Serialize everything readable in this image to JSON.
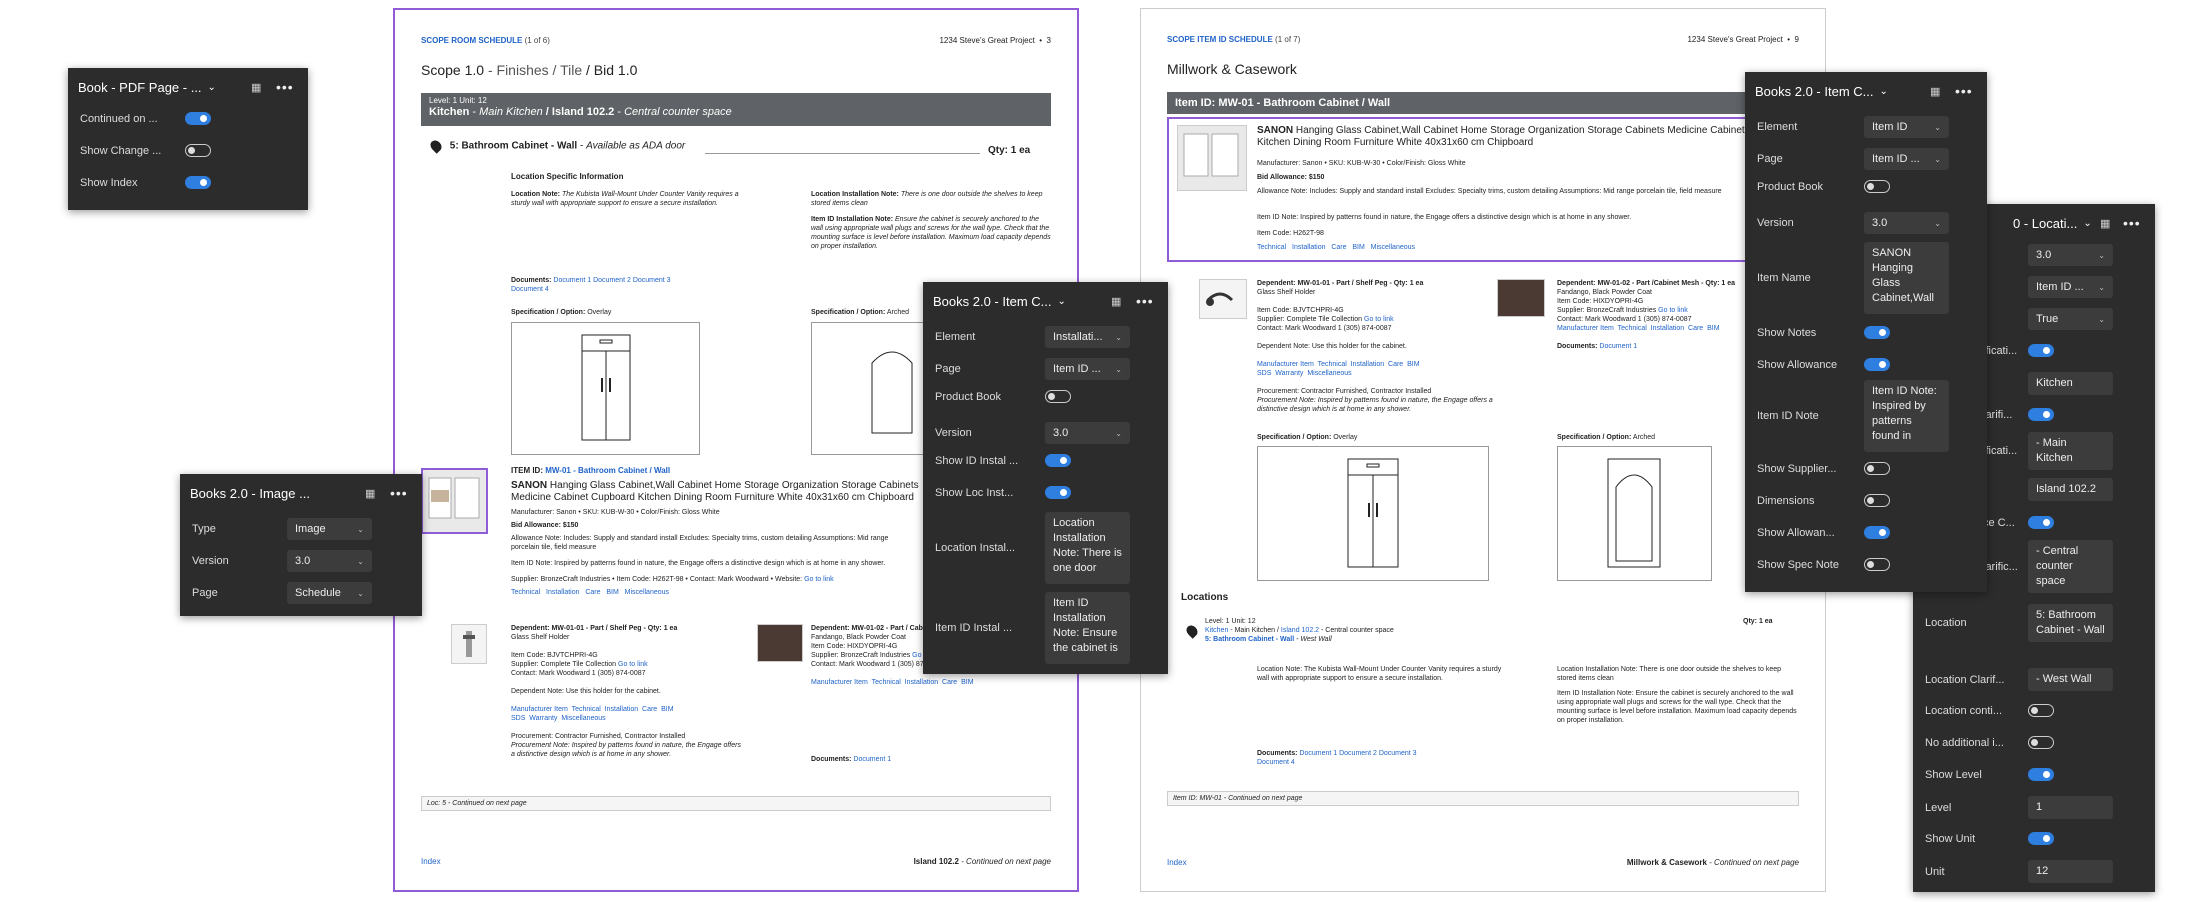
{
  "page1": {
    "header_left": "SCOPE ROOM SCHEDULE",
    "header_count": "(1 of 6)",
    "header_project": "1234 Steve's Great Project",
    "header_num": "3",
    "title_scope": "Scope 1.0",
    "title_sep1": "-",
    "title_finish": "Finishes / Tile",
    "title_sep2": "/",
    "title_bid": "Bid 1.0",
    "band_level": "Level: 1 Unit: 12",
    "band_room": "Kitchen",
    "band_dash": "-",
    "band_main": "Main Kitchen",
    "band_slash": "/",
    "band_island": "Island 102.2",
    "band_dash2": "-",
    "band_desc": "Central counter space",
    "loc_item": "5: Bathroom Cabinet - Wall",
    "loc_dash": "-",
    "loc_avail": "Available as ADA door",
    "qty": "Qty: 1 ea",
    "lsi": "Location Specific Information",
    "loc_note_label": "Location Note:",
    "loc_note": "The Kubista Wall-Mount Under Counter Vanity requires a sturdy wall with appropriate support to ensure a secure installation.",
    "lin_label": "Location Installation Note:",
    "lin_note": "There is one door outside the shelves to keep stored items clean",
    "iin_label": "Item ID Installation Note:",
    "iin_note": "Ensure the cabinet is securely anchored to the wall using appropriate wall plugs and screws for the wall type. Check that the mounting surface is level before installation. Maximum load capacity depends on proper installation.",
    "docs_label": "Documents:",
    "docs": [
      "Document 1",
      "Document 2",
      "Document 3",
      "Document 4"
    ],
    "spec_label": "Specification / Option:",
    "spec_left": "Overlay",
    "spec_right": "Arched",
    "item_id_label": "ITEM ID:",
    "item_id": "MW-01 - Bathroom Cabinet / Wall",
    "item_brand": "SANON",
    "item_desc": "Hanging Glass Cabinet,Wall Cabinet Home Storage Organization Storage Cabinets Medicine Cabinet Cupboard Kitchen Dining Room Furniture White 40x31x60 cm Chipboard",
    "mfr_line": "Manufacturer: Sanon  •  SKU: KUB-W-30  •  Color/Finish: Gloss White",
    "bid_allow": "Bid Allowance: $150",
    "allow_note": "Allowance Note: Includes: Supply and standard install  Excludes: Specialty trims, custom detailing  Assumptions: Mid range porcelain tile, field measure",
    "itemid_note": "Item ID Note: Inspired by patterns found in nature, the Engage offers a distinctive design which is at home in any shower.",
    "supplier_line": "Supplier: BronzeCraft Industries  •  Item Code: H262T-98  •  Contact: Mark Woodward  •  Website:",
    "go_link": "Go to link",
    "tech_links": [
      "Technical",
      "Installation",
      "Care",
      "BIM",
      "Miscellaneous"
    ],
    "dep1_title": "Dependent: MW-01-01 - Part / Shelf Peg - Qty: 1 ea",
    "dep1_sub": "Glass Shelf Holder",
    "dep1_code": "Item Code: BJVTCHPRI-4G",
    "dep1_supplier": "Supplier: Complete Tile Collection",
    "dep1_contact": "Contact: Mark Woodward  1 (305) 874-0087",
    "dep1_note": "Dependent Note: Use this holder for the cabinet.",
    "dep1_links": [
      "Manufacturer Item",
      "Technical",
      "Installation",
      "Care",
      "BIM",
      "SDS",
      "Warranty",
      "Miscellaneous"
    ],
    "dep1_proc": "Procurement: Contractor Furnished, Contractor Installed",
    "dep1_pnote": "Procurement Note: Inspired by patterns found in nature, the Engage offers a distinctive design which is at home in any shower.",
    "dep2_title": "Dependent: MW-01-02 - Part / Cabinet Mesh - Qty: 1 ea",
    "dep2_sub": "Fandango, Black Powder Coat",
    "dep2_code": "Item Code: HIXDYOPRI-4G",
    "dep2_supplier": "Supplier: BronzeCraft Industries",
    "dep2_contact": "Contact: Mark Woodward  1 (305) 874-0087",
    "dep2_links": [
      "Manufacturer Item",
      "Technical",
      "Installation",
      "Care",
      "BIM"
    ],
    "dep2_docs": "Documents:",
    "dep2_doc1": "Document 1",
    "cont": "Loc: 5 - Continued on next page",
    "foot_left": "Index",
    "foot_right_b": "Island 102.2",
    "foot_right": "- Continued on next page"
  },
  "page2": {
    "header_left": "SCOPE ITEM ID SCHEDULE",
    "header_count": "(1 of 7)",
    "header_project": "1234 Steve's Great Project",
    "header_num": "9",
    "title": "Millwork & Casework",
    "band": "Item ID: MW-01 - Bathroom Cabinet / Wall",
    "item_brand": "SANON",
    "item_desc": "Hanging Glass Cabinet,Wall Cabinet Home Storage Organization Storage Cabinets Medicine Cabinet Cupboard Kitchen Dining Room Furniture White 40x31x60 cm Chipboard",
    "mfr_line": "Manufacturer: Sanon  •  SKU: KUB-W-30  •  Color/Finish: Gloss White",
    "bid_allow": "Bid Allowance: $150",
    "allow_note": "Allowance Note: Includes: Supply and standard install  Excludes: Specialty trims, custom detailing  Assumptions: Mid range porcelain tile, field measure",
    "itemid_note": "Item ID Note: Inspired by patterns found in nature, the Engage offers a distinctive design which is at home in any shower.",
    "item_code": "Item Code: H262T-98",
    "tech_links": [
      "Technical",
      "Installation",
      "Care",
      "BIM",
      "Miscellaneous"
    ],
    "dep1_title": "Dependent: MW-01-01 - Part / Shelf Peg - Qty: 1 ea",
    "dep1_sub": "Glass Shelf Holder",
    "dep1_code": "Item Code: BJVTCHPRI-4G",
    "dep1_supplier": "Supplier: Complete Tile Collection",
    "go_link": "Go to link",
    "dep1_contact": "Contact: Mark Woodward  1 (305) 874-0087",
    "dep1_note": "Dependent Note: Use this holder for the cabinet.",
    "dep1_links": [
      "Manufacturer Item",
      "Technical",
      "Installation",
      "Care",
      "BIM",
      "SDS",
      "Warranty",
      "Miscellaneous"
    ],
    "dep1_proc": "Procurement: Contractor Furnished, Contractor Installed",
    "dep1_pnote": "Procurement Note: Inspired by patterns found in nature, the Engage offers a distinctive design which is at home in any shower.",
    "dep2_title": "Dependent: MW-01-02 - Part /Cabinet Mesh - Qty: 1 ea",
    "dep2_sub": "Fandango, Black Powder Coat",
    "dep2_code": "Item Code: HIXDYOPRI-4G",
    "dep2_supplier": "Supplier: BronzeCraft Industries",
    "dep2_contact": "Contact: Mark Woodward  1 (305) 874-0087",
    "dep2_links": [
      "Manufacturer Item",
      "Technical",
      "Installation",
      "Care",
      "BIM"
    ],
    "dep2_docs": "Documents:",
    "dep2_doc1": "Document 1",
    "spec_label": "Specification / Option:",
    "spec_left": "Overlay",
    "spec_right": "Arched",
    "locations": "Locations",
    "loc_level": "Level: 1  Unit: 12",
    "loc_qty": "Qty: 1 ea",
    "loc_path1": "Kitchen",
    "loc_path2": "- Main Kitchen  /",
    "loc_path3": "Island 102.2",
    "loc_path4": "- Central counter space",
    "loc_item": "5: Bathroom Cabinet - Wall",
    "loc_item2": "- West Wall",
    "loc_note": "Location Note: The Kubista Wall-Mount Under Counter Vanity requires a sturdy wall with appropriate support to ensure a secure installation.",
    "lin_note": "Location Installation Note: There is one door outside the shelves to keep stored items clean",
    "iin_note": "Item ID Installation Note: Ensure the cabinet is securely anchored to the wall using appropriate wall plugs and screws for the wall type. Check that the mounting surface is level before installation. Maximum load capacity depends on proper installation.",
    "docs_label": "Documents:",
    "docs": [
      "Document 1",
      "Document 2",
      "Document 3",
      "Document 4"
    ],
    "cont": "Item ID: MW-01 - Continued on next page",
    "foot_left": "Index",
    "foot_right_b": "Millwork & Casework",
    "foot_right": "- Continued on next page"
  },
  "panelA": {
    "title": "Book - PDF Page - ...",
    "rows": [
      {
        "label": "Continued on ...",
        "on": true
      },
      {
        "label": "Show Change ...",
        "on": false
      },
      {
        "label": "Show Index",
        "on": true
      }
    ]
  },
  "panelB": {
    "title": "Books 2.0 - Image ...",
    "rows": [
      {
        "label": "Type",
        "value": "Image"
      },
      {
        "label": "Version",
        "value": "3.0"
      },
      {
        "label": "Page",
        "value": "Schedule"
      }
    ]
  },
  "panelC": {
    "title": "Books 2.0 - Item C...",
    "element_label": "Element",
    "element": "Installati...",
    "page_label": "Page",
    "page": "Item ID ...",
    "pb_label": "Product Book",
    "version_label": "Version",
    "version": "3.0",
    "sid_label": "Show ID Instal ...",
    "sloc_label": "Show Loc Inst...",
    "lin_label": "Location Instal...",
    "lin_value": "Location Installation Note: There is one door",
    "iin_label": "Item ID Instal ...",
    "iin_value": "Item ID Installation Note: Ensure the cabinet is"
  },
  "panelD": {
    "title": "Books 2.0 - Item C...",
    "element_label": "Element",
    "element": "Item ID",
    "page_label": "Page",
    "page": "Item ID ...",
    "pb_label": "Product Book",
    "version_label": "Version",
    "version": "3.0",
    "name_label": "Item Name",
    "name_value": "SANON Hanging Glass Cabinet,Wall",
    "notes_label": "Show Notes",
    "allow_label": "Show Allowance",
    "note_label": "Item ID Note",
    "note_value": "Item ID Note: Inspired by patterns found in",
    "supp_label": "Show Supplier...",
    "dim_label": "Dimensions",
    "allow2_label": "Show Allowan...",
    "spec_label": "Show Spec Note"
  },
  "panelE": {
    "title": "0 - Locati...",
    "v1": "3.0",
    "v2": "Item ID ...",
    "v3": "True",
    "fr1": "ificati...",
    "t1": "Kitchen",
    "fr2": "larifi...",
    "fr3": "ificati...",
    "t2": "- Main Kitchen",
    "t3": "Island 102.2",
    "fr4": "ce C...",
    "fr5": "larific...",
    "t4": "- Central counter space",
    "loc_label": "Location",
    "loc_value": "5: Bathroom Cabinet - Wall",
    "lc_label": "Location Clarif...",
    "lc_value": "- West Wall",
    "lcont_label": "Location conti...",
    "noadd_label": "No additional i...",
    "slevel_label": "Show Level",
    "level_label": "Level",
    "level_value": "1",
    "sunit_label": "Show Unit",
    "unit_label": "Unit",
    "unit_value": "12"
  },
  "colors": {
    "accent": "#2f7fe0",
    "purple": "#8f5bd6",
    "link": "#1f63c9",
    "panel": "#2c2c2c"
  }
}
